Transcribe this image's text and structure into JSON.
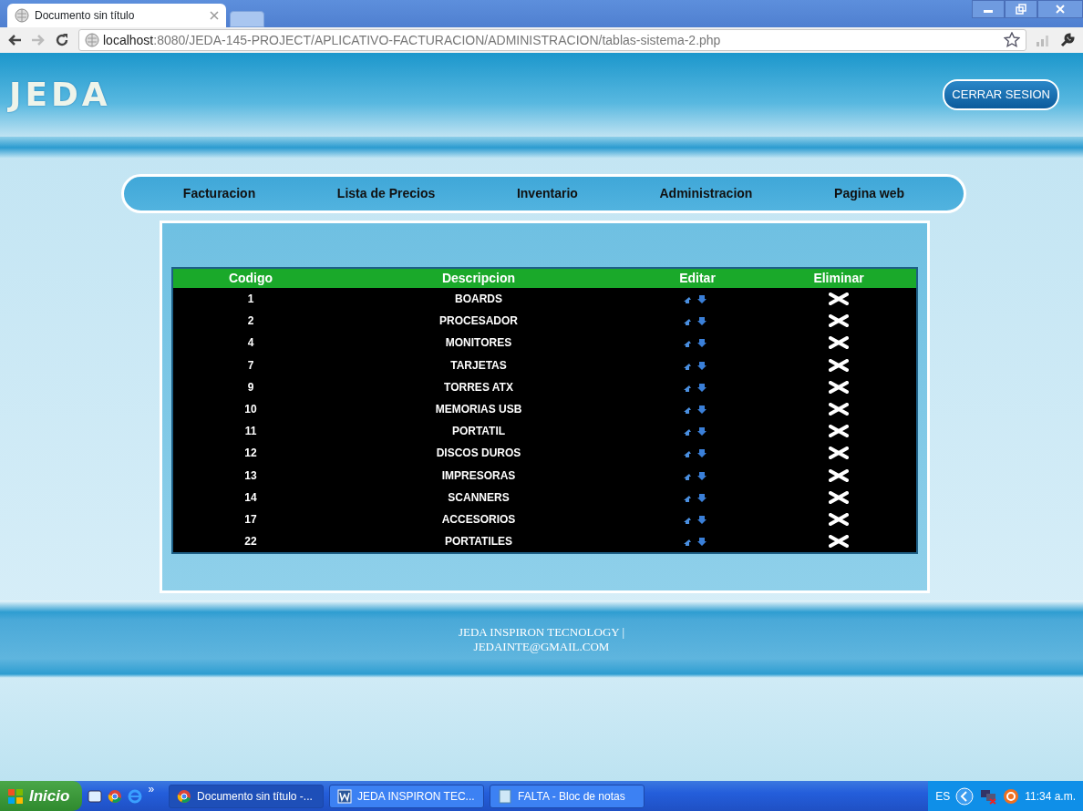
{
  "browser": {
    "tabs": [
      {
        "title": "Documento sin título",
        "selected": true
      }
    ],
    "url_host": "localhost",
    "url_path": ":8080/JEDA-145-PROJECT/APLICATIVO-FACTURACION/ADMINISTRACION/tablas-sistema-2.php"
  },
  "page": {
    "logo": "JEDA",
    "logout": "CERRAR SESION",
    "nav": [
      "Facturacion",
      "Lista de Precios",
      "Inventario",
      "Administracion",
      "Pagina web"
    ],
    "table": {
      "columns": [
        "Codigo",
        "Descripcion",
        "Editar",
        "Eliminar"
      ],
      "rows": [
        {
          "codigo": "1",
          "descripcion": "BOARDS"
        },
        {
          "codigo": "2",
          "descripcion": "PROCESADOR"
        },
        {
          "codigo": "4",
          "descripcion": "MONITORES"
        },
        {
          "codigo": "7",
          "descripcion": "TARJETAS"
        },
        {
          "codigo": "9",
          "descripcion": "TORRES ATX"
        },
        {
          "codigo": "10",
          "descripcion": "MEMORIAS USB"
        },
        {
          "codigo": "11",
          "descripcion": "PORTATIL"
        },
        {
          "codigo": "12",
          "descripcion": "DISCOS DUROS"
        },
        {
          "codigo": "13",
          "descripcion": "IMPRESORAS"
        },
        {
          "codigo": "14",
          "descripcion": "SCANNERS"
        },
        {
          "codigo": "17",
          "descripcion": "ACCESORIOS"
        },
        {
          "codigo": "22",
          "descripcion": "PORTATILES"
        }
      ]
    },
    "footer": [
      "JEDA INSPIRON TECNOLOGY |",
      "JEDAINTE@GMAIL.COM"
    ]
  },
  "taskbar": {
    "start": "Inicio",
    "more": "»",
    "tasks": [
      {
        "label": "Documento sin título -...",
        "kind": "chrome",
        "selected": true
      },
      {
        "label": "JEDA INSPIRON TEC...",
        "kind": "word",
        "selected": false
      },
      {
        "label": "FALTA - Bloc de notas",
        "kind": "notepad",
        "selected": false
      }
    ],
    "language": "ES",
    "clock": "11:34 a.m."
  }
}
